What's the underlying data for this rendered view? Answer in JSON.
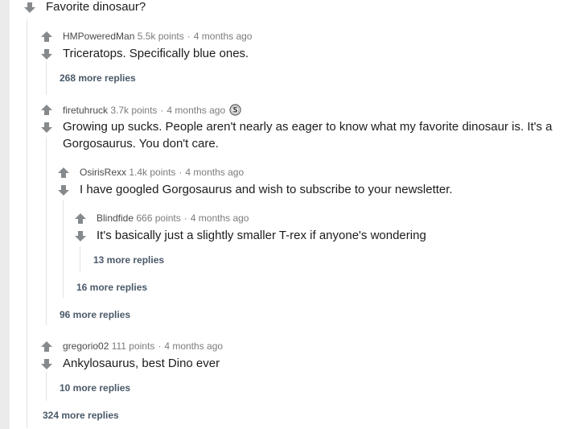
{
  "parent": {
    "question": "Favorite dinosaur?"
  },
  "comments": [
    {
      "author": "HMPoweredMan",
      "points": "5.5k points",
      "time": "4 months ago",
      "text": "Triceratops. Specifically blue ones.",
      "more_replies": "268 more replies"
    },
    {
      "author": "firetuhruck",
      "points": "3.7k points",
      "time": "4 months ago",
      "award_icon": "silver-award-icon",
      "text_line1": "Growing up sucks. People aren't nearly as eager to know what my favorite dinosaur is. It's a",
      "text_line2": "Gorgosaurus. You don't care.",
      "more_replies": "96 more replies",
      "replies": [
        {
          "author": "OsirisRexx",
          "points": "1.4k points",
          "time": "4 months ago",
          "text": "I have googled Gorgosaurus and wish to subscribe to your newsletter.",
          "more_replies": "16 more replies",
          "replies": [
            {
              "author": "Blindfide",
              "points": "666 points",
              "time": "4 months ago",
              "text": "It's basically just a slightly smaller T-rex if anyone's wondering",
              "more_replies": "13 more replies"
            }
          ]
        }
      ]
    },
    {
      "author": "gregorio02",
      "points": "111 points",
      "time": "4 months ago",
      "text": "Ankylosaurus, best Dino ever",
      "more_replies": "10 more replies"
    }
  ],
  "thread_more_replies": "324 more replies",
  "colors": {
    "arrow": "#878a8c",
    "rail": "#ebebeb",
    "thread_line": "#e2e2e2",
    "more_link": "#4a5968"
  }
}
